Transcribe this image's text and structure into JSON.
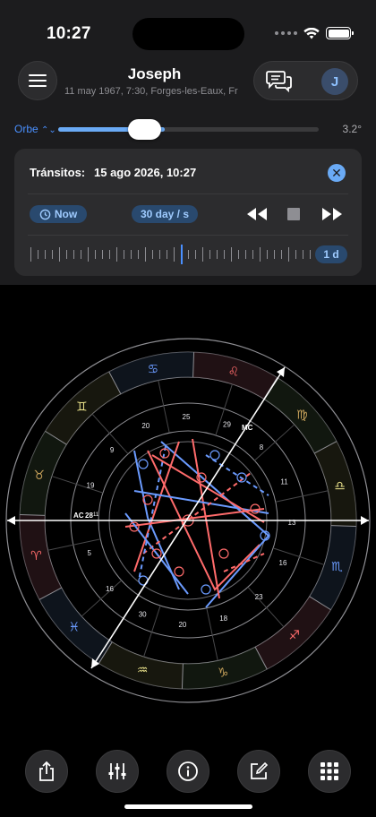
{
  "status": {
    "time": "10:27"
  },
  "header": {
    "name": "Joseph",
    "subtitle": "11 may 1967, 7:30, Forges-les-Eaux, Fr",
    "avatar_initial": "J"
  },
  "orbe": {
    "label": "Orbe",
    "value": "3.2°",
    "level": 0.41
  },
  "transit": {
    "label": "Tránsitos:",
    "date": "15 ago 2026, 10:27",
    "now_label": "Now",
    "speed_label": "30 day / s",
    "step_label": "1 d"
  },
  "chart": {
    "ascendant_label": "AC",
    "ascendant_degree": "28",
    "ascendant_minute": "11",
    "mc_label": "MC",
    "signs": [
      "♈",
      "♉",
      "♊",
      "♋",
      "♌",
      "♍",
      "♎",
      "♏",
      "♐",
      "♑",
      "♒",
      "♓"
    ],
    "degree_labels": [
      "19",
      "9",
      "20",
      "25",
      "29",
      "8",
      "11",
      "13",
      "16",
      "23",
      "18",
      "20",
      "30",
      "16",
      "5"
    ]
  },
  "toolbar": {
    "share": "share-icon",
    "settings": "sliders-icon",
    "info": "info-icon",
    "edit": "edit-icon",
    "grid": "grid-icon"
  },
  "colors": {
    "accent": "#4a90ff",
    "chip_bg": "#29496e",
    "aspect_red": "#ff6b6b",
    "aspect_blue": "#6b9bff",
    "background": "#1c1c1e"
  }
}
